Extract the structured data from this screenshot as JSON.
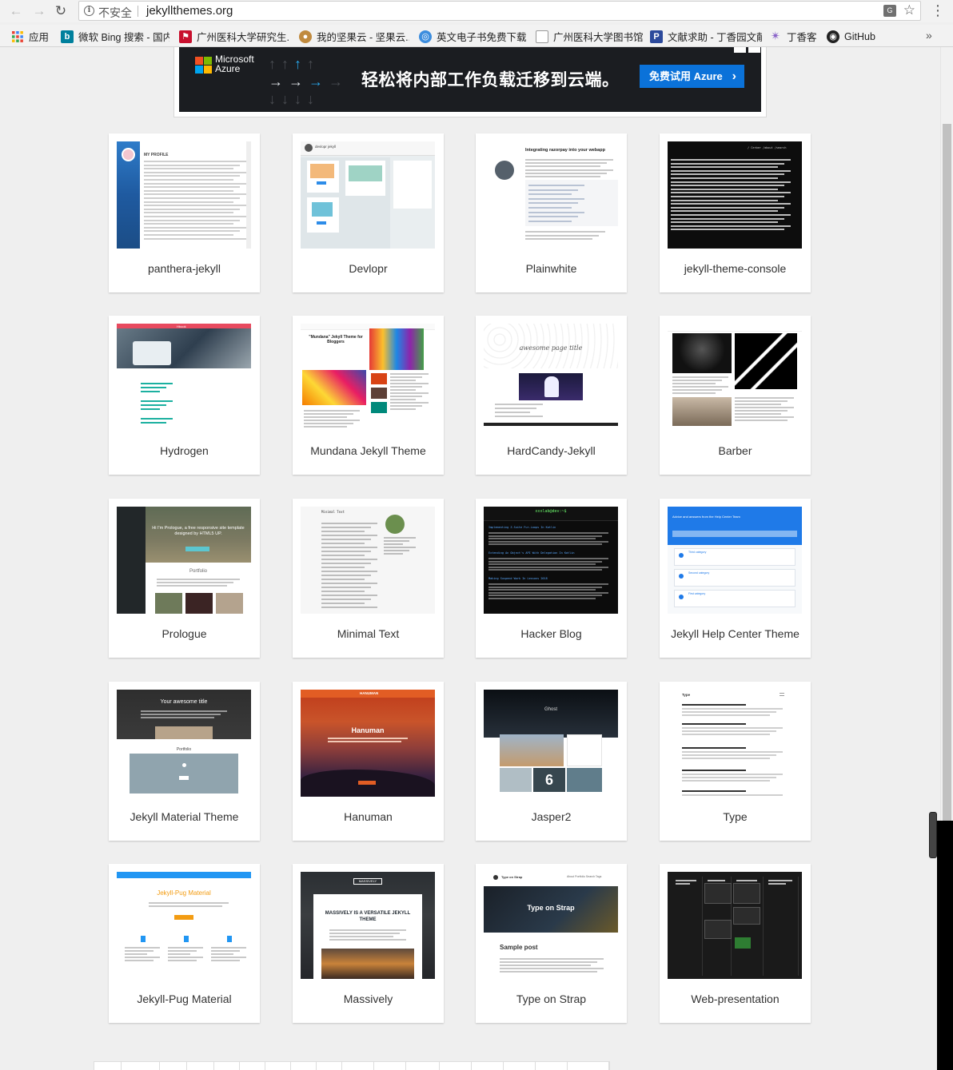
{
  "browser": {
    "security_label": "不安全",
    "url": "jekyllthemes.org",
    "translate_icon": "translate-icon",
    "bookmarks": [
      {
        "label": "应用",
        "icon": "apps-grid-icon",
        "color": "#4285f4"
      },
      {
        "label": "微软 Bing 搜索 - 国内...",
        "icon": "bing-icon",
        "color": "#00809d"
      },
      {
        "label": "广州医科大学研究生...",
        "icon": "school-icon",
        "color": "#c8102e"
      },
      {
        "label": "我的坚果云 - 坚果云...",
        "icon": "nut-icon",
        "color": "#c08a3e"
      },
      {
        "label": "英文电子书免费下载",
        "icon": "globe-icon",
        "color": "#3c8dde"
      },
      {
        "label": "广州医科大学图书馆",
        "icon": "page-icon",
        "color": "#999999"
      },
      {
        "label": "文献求助 - 丁香园文献...",
        "icon": "p-icon",
        "color": "#2c4a9c"
      },
      {
        "label": "丁香客",
        "icon": "dxy-icon",
        "color": "#8a63c9"
      },
      {
        "label": "GitHub",
        "icon": "github-icon",
        "color": "#222222"
      }
    ]
  },
  "ad": {
    "brand_line1": "Microsoft",
    "brand_line2": "Azure",
    "slogan": "轻松将内部工作负载迁移到云端。",
    "cta": "免费试用 Azure",
    "colors": {
      "ms_red": "#f25022",
      "ms_green": "#7fba00",
      "ms_blue": "#00a4ef",
      "ms_yellow": "#ffb900",
      "cta": "#0b72d9"
    }
  },
  "themes": [
    {
      "title": "panthera-jekyll",
      "thumb": "panthera"
    },
    {
      "title": "Devlopr",
      "thumb": "devlopr"
    },
    {
      "title": "Plainwhite",
      "thumb": "plainwhite"
    },
    {
      "title": "jekyll-theme-console",
      "thumb": "console"
    },
    {
      "title": "Hydrogen",
      "thumb": "hydrogen"
    },
    {
      "title": "Mundana Jekyll Theme",
      "thumb": "mundana"
    },
    {
      "title": "HardCandy-Jekyll",
      "thumb": "hardcandy"
    },
    {
      "title": "Barber",
      "thumb": "barber"
    },
    {
      "title": "Prologue",
      "thumb": "prologue"
    },
    {
      "title": "Minimal Text",
      "thumb": "minimal"
    },
    {
      "title": "Hacker Blog",
      "thumb": "hacker"
    },
    {
      "title": "Jekyll Help Center Theme",
      "thumb": "helpcenter"
    },
    {
      "title": "Jekyll Material Theme",
      "thumb": "material"
    },
    {
      "title": "Hanuman",
      "thumb": "hanuman"
    },
    {
      "title": "Jasper2",
      "thumb": "jasper"
    },
    {
      "title": "Type",
      "thumb": "type"
    },
    {
      "title": "Jekyll-Pug Material",
      "thumb": "pug"
    },
    {
      "title": "Massively",
      "thumb": "massively"
    },
    {
      "title": "Type on Strap",
      "thumb": "typeonstrap"
    },
    {
      "title": "Web-presentation",
      "thumb": "webpres"
    }
  ],
  "thumb_text": {
    "panthera_heading": "MY PROFILE",
    "devlopr_name": "devlopr jekyll",
    "plainwhite_title": "Integrating razorpay into your webapp",
    "console_header": "/ Cerber /about /search",
    "hydrogen_nav": "Hbook",
    "mundana_heading": "\"Mundana\" Jekyll Theme for Bloggers",
    "hardcandy_heading": "awesome page title",
    "minimal_title": "Minimal Text",
    "hacker_title": "xxxlab@dev:~$",
    "hacker_posts": [
      "Implementing Z-Suite Fur-Loops In Kotlin",
      "Extending An Object's API With Delegation In Kotlin",
      "Making Suspend Work In Lessons 2018"
    ],
    "helpcenter_title": "Advice and answers from the Help Center Team",
    "helpcenter_sections": [
      "Third category",
      "Second category",
      "First category"
    ],
    "material_title": "Your awesome title",
    "material_portfolio": "Portfolio",
    "hanuman_title": "Hanuman",
    "hanuman_brand": "HANUMAN",
    "jasper_brand": "Ghost",
    "jasper_tile": "6",
    "type_brand": "Type",
    "pug_title": "Jekyll-Pug Material",
    "massively_logo": "MASSIVELY",
    "massively_heading": "MASSIVELY IS A VERSATILE JEKYLL THEME",
    "tos_brand": "Type on Strap",
    "tos_nav": "About  Portfolio  Search  Tags",
    "tos_post": "Sample post",
    "prologue_heading": "Hi I'm Prologue, a free responsive site template designed by HTML5 UP.",
    "prologue_section": "Portfolio"
  }
}
